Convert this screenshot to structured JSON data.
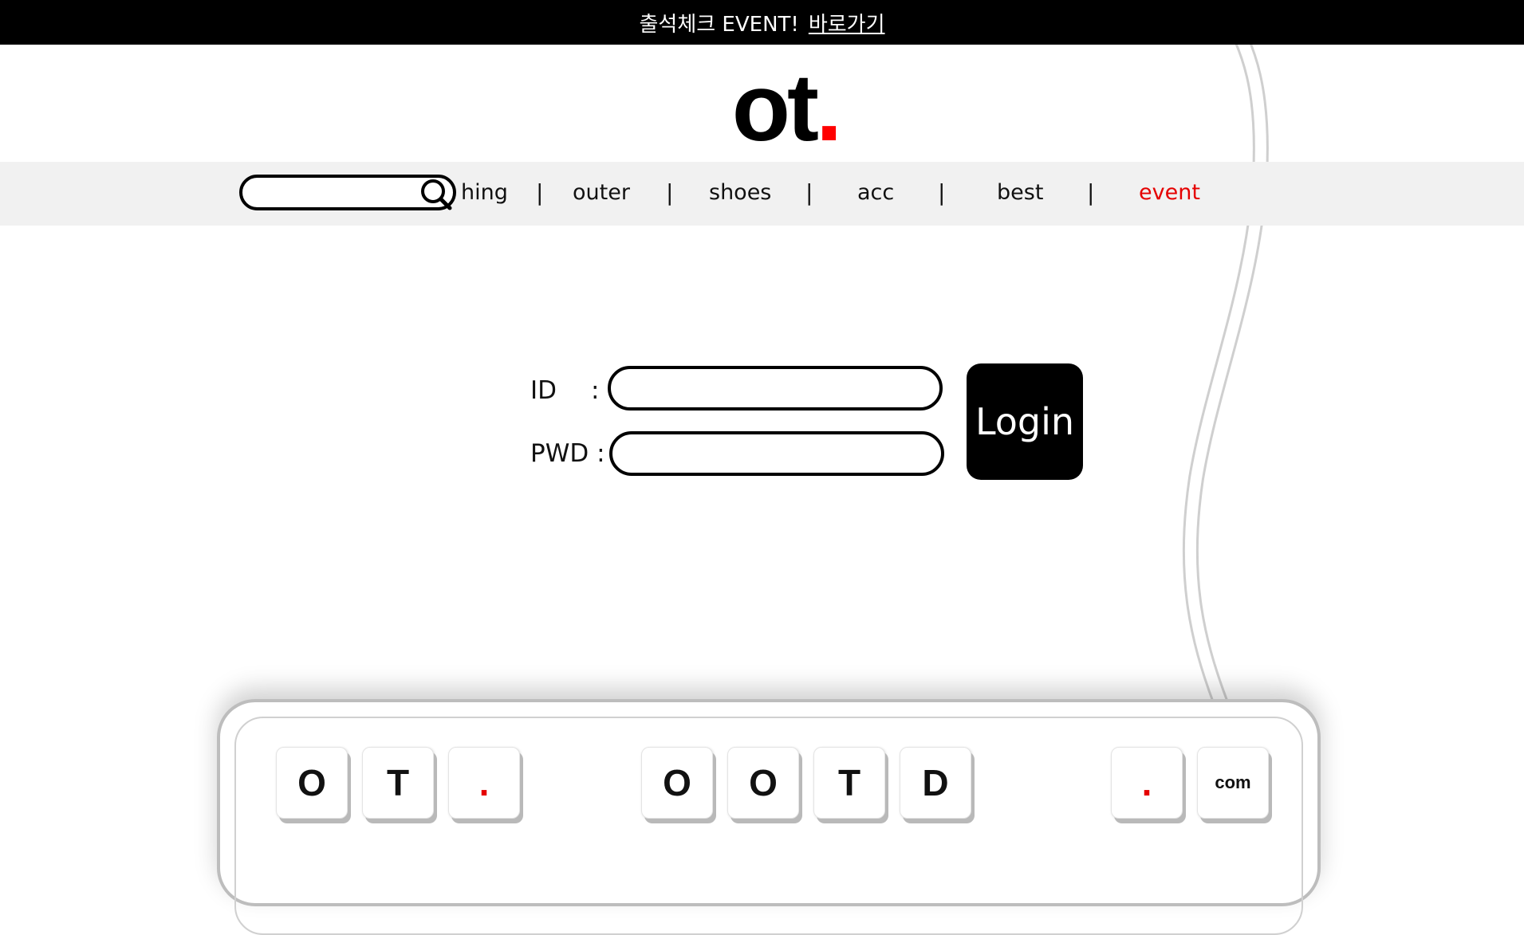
{
  "topbar": {
    "text": "출석체크 EVENT!",
    "link": "바로가기"
  },
  "logo": {
    "text": "ot",
    "dot": "."
  },
  "search": {
    "placeholder": "",
    "value": ""
  },
  "nav": {
    "items": [
      "hing",
      "outer",
      "shoes",
      "acc",
      "best",
      "event"
    ],
    "separator": "|"
  },
  "login_form": {
    "id_label": "ID",
    "id_colon": ":",
    "pwd_label": "PWD :",
    "id_value": "",
    "pwd_value": "",
    "button_label": "Login"
  },
  "keyboard": {
    "keys": [
      "O",
      "T",
      ".",
      "O",
      "O",
      "T",
      "D",
      ".",
      "com"
    ]
  },
  "colors": {
    "accent": "#e50000",
    "topbar_bg": "#000000",
    "nav_bg": "#f1f1f1"
  },
  "icons": [
    "search-icon",
    "cable-decoration"
  ]
}
